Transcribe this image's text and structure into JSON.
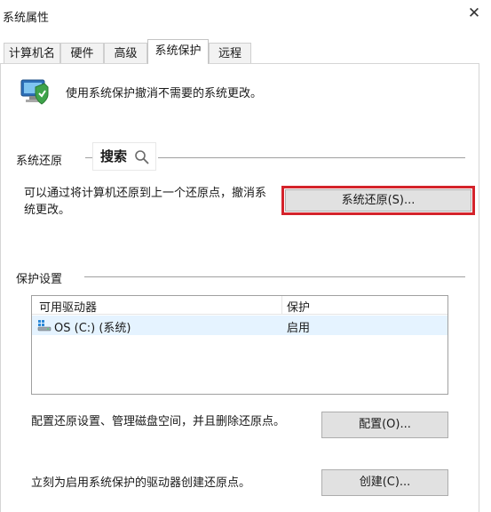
{
  "window": {
    "title": "系统属性",
    "close_glyph": "✕"
  },
  "tabs": [
    {
      "label": "计算机名",
      "active": false
    },
    {
      "label": "硬件",
      "active": false
    },
    {
      "label": "高级",
      "active": false
    },
    {
      "label": "系统保护",
      "active": true
    },
    {
      "label": "远程",
      "active": false
    }
  ],
  "intro": {
    "text": "使用系统保护撤消不需要的系统更改。",
    "icon": "system-protection-icon"
  },
  "restore_section": {
    "heading": "系统还原",
    "search_overlay": "搜索",
    "description_line1": "可以通过将计算机还原到上一个还原点，撤消系",
    "description_line2": "统更改。",
    "button": "系统还原(S)...",
    "highlight_color": "#d4232b"
  },
  "protection_section": {
    "heading": "保护设置",
    "columns": [
      "可用驱动器",
      "保护"
    ],
    "rows": [
      {
        "drive": "OS (C:) (系统)",
        "protection": "启用",
        "icon": "drive-icon"
      }
    ],
    "configure_text": "配置还原设置、管理磁盘空间，并且删除还原点。",
    "configure_button": "配置(O)...",
    "create_text": "立刻为启用系统保护的驱动器创建还原点。",
    "create_button": "创建(C)..."
  }
}
